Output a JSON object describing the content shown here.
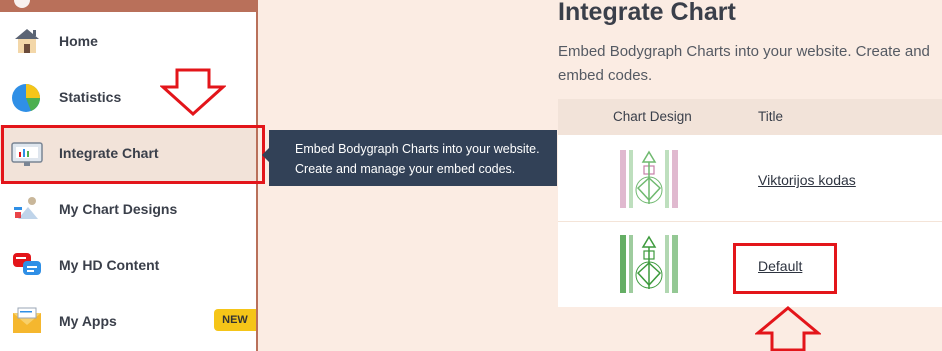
{
  "sidebar": {
    "items": [
      {
        "label": "Home",
        "icon": "home-icon"
      },
      {
        "label": "Statistics",
        "icon": "pie-chart-icon"
      },
      {
        "label": "Integrate Chart",
        "icon": "monitor-chart-icon",
        "active": true
      },
      {
        "label": "My Chart Designs",
        "icon": "design-figure-icon"
      },
      {
        "label": "My HD Content",
        "icon": "chat-bubbles-icon"
      },
      {
        "label": "My Apps",
        "icon": "envelope-icon",
        "badge": "NEW"
      }
    ]
  },
  "tooltip": {
    "line1": "Embed Bodygraph Charts into your website.",
    "line2": "Create and manage your embed codes."
  },
  "main": {
    "title": "Integrate Chart",
    "description_line1": "Embed Bodygraph Charts into your website. Create and",
    "description_line2": "embed codes."
  },
  "table": {
    "headers": [
      "Chart Design",
      "Title"
    ],
    "rows": [
      {
        "title": "Viktorijos kodas",
        "thumb_color": "#c67fa8"
      },
      {
        "title": "Default",
        "thumb_color": "#3d9a3d"
      }
    ]
  },
  "colors": {
    "annotation_red": "#e3151a",
    "sidebar_border": "#b9705a",
    "tooltip_bg": "#324157",
    "badge_yellow": "#f5c518"
  }
}
